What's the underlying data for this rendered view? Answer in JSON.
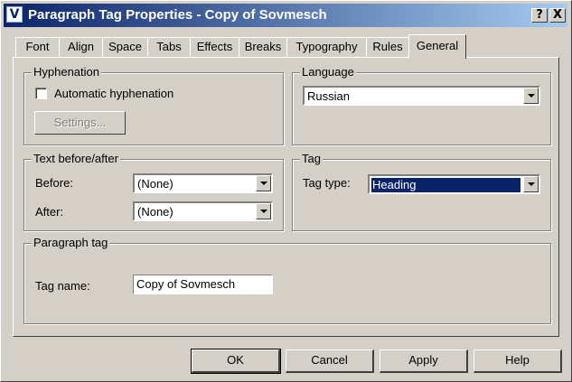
{
  "window": {
    "title": "Paragraph Tag Properties - Copy of Sovmesch",
    "app_icon_letter": "V",
    "help_label": "?",
    "close_label": "X"
  },
  "tabs": [
    {
      "label": "Font"
    },
    {
      "label": "Align"
    },
    {
      "label": "Space"
    },
    {
      "label": "Tabs"
    },
    {
      "label": "Effects"
    },
    {
      "label": "Breaks"
    },
    {
      "label": "Typography"
    },
    {
      "label": "Rules"
    },
    {
      "label": "General",
      "active": true
    }
  ],
  "hyphenation": {
    "group_label": "Hyphenation",
    "checkbox_label": "Automatic hyphenation",
    "checked": false,
    "settings_label": "Settings..."
  },
  "language": {
    "group_label": "Language",
    "value": "Russian"
  },
  "text_before_after": {
    "group_label": "Text before/after",
    "before_label": "Before:",
    "before_value": "(None)",
    "after_label": "After:",
    "after_value": "(None)"
  },
  "tag": {
    "group_label": "Tag",
    "type_label": "Tag type:",
    "type_value": "Heading"
  },
  "paragraph_tag": {
    "group_label": "Paragraph tag",
    "name_label": "Tag name:",
    "name_value": "Copy of Sovmesch"
  },
  "footer": {
    "ok": "OK",
    "cancel": "Cancel",
    "apply": "Apply",
    "help": "Help"
  },
  "colors": {
    "face": "#d4d0c8",
    "title_start": "#0a246a",
    "title_end": "#a6caf0",
    "selection": "#0a246a"
  }
}
